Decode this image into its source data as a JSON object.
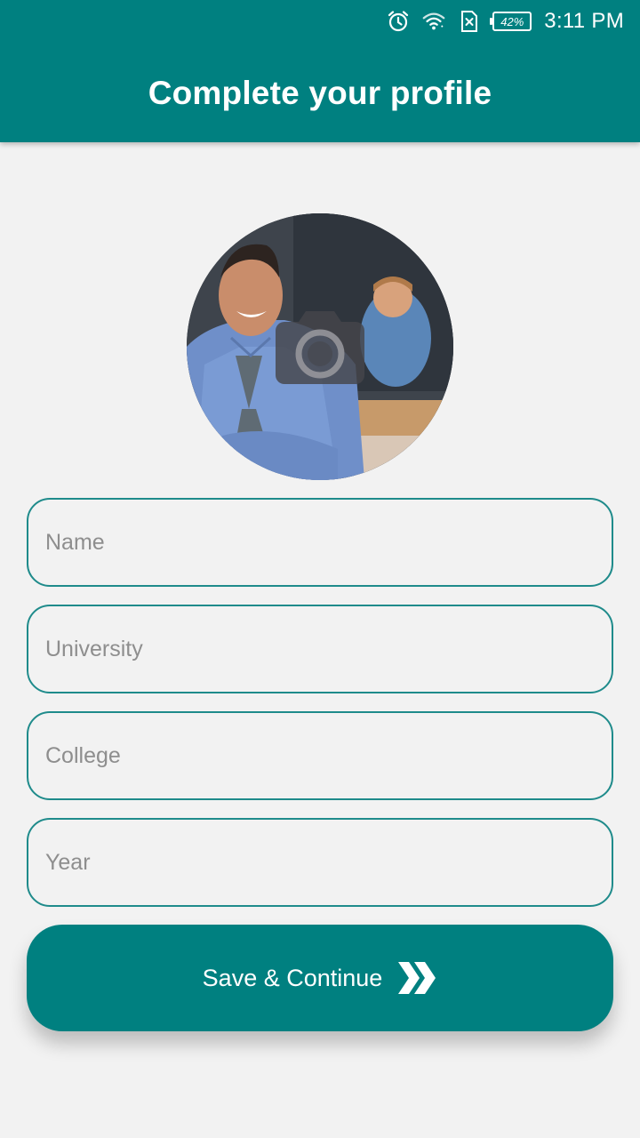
{
  "status_bar": {
    "icons": [
      "alarm-icon",
      "wifi-icon",
      "no-sim-icon",
      "battery-icon"
    ],
    "battery_percent": "42%",
    "time": "3:11 PM"
  },
  "app_bar": {
    "title": "Complete your profile"
  },
  "avatar": {
    "icon": "camera-icon"
  },
  "form": {
    "name_placeholder": "Name",
    "university_placeholder": "University",
    "college_placeholder": "College",
    "year_placeholder": "Year"
  },
  "save_button": {
    "label": "Save & Continue",
    "icon": "double-chevron-right-icon"
  },
  "colors": {
    "primary": "#008080",
    "background": "#f2f2f2",
    "field_border": "#1f8b8b",
    "placeholder": "#8e8e8e"
  }
}
